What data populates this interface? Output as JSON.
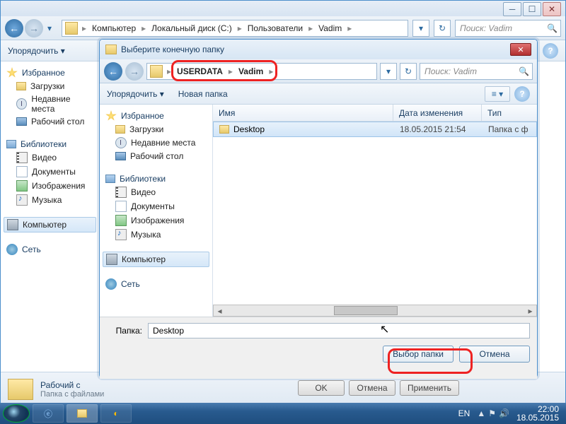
{
  "bg": {
    "breadcrumbs": [
      "Компьютер",
      "Локальный диск (C:)",
      "Пользователи",
      "Vadim"
    ],
    "search_placeholder": "Поиск: Vadim",
    "toolbar": {
      "organize": "Упорядочить ▾"
    },
    "help_q": "?",
    "sidebar": {
      "fav_hdr": "Избранное",
      "fav": [
        "Загрузки",
        "Недавние места",
        "Рабочий стол"
      ],
      "lib_hdr": "Библиотеки",
      "lib": [
        "Видео",
        "Документы",
        "Изображения",
        "Музыка"
      ],
      "computer_hdr": "Компьютер",
      "network_hdr": "Сеть"
    },
    "footer_title": "Рабочий с",
    "footer_sub": "Папка с файлами",
    "btn_ok": "OK",
    "btn_cancel": "Отмена",
    "btn_apply": "Применить"
  },
  "dlg": {
    "title": "Выберите конечную папку",
    "breadcrumbs": [
      "USERDATA",
      "Vadim"
    ],
    "search_placeholder": "Поиск: Vadim",
    "toolbar": {
      "organize": "Упорядочить ▾",
      "newfolder": "Новая папка"
    },
    "cols": {
      "name": "Имя",
      "date": "Дата изменения",
      "type": "Тип"
    },
    "row": {
      "name": "Desktop",
      "date": "18.05.2015 21:54",
      "type": "Папка с ф"
    },
    "folder_label": "Папка:",
    "folder_value": "Desktop",
    "btn_select": "Выбор папки",
    "btn_cancel": "Отмена",
    "sidebar": {
      "fav_hdr": "Избранное",
      "fav": [
        "Загрузки",
        "Недавние места",
        "Рабочий стол"
      ],
      "lib_hdr": "Библиотеки",
      "lib": [
        "Видео",
        "Документы",
        "Изображения",
        "Музыка"
      ],
      "computer_hdr": "Компьютер",
      "network_hdr": "Сеть"
    }
  },
  "taskbar": {
    "lang": "EN",
    "time": "22:00",
    "date": "18.05.2015"
  }
}
